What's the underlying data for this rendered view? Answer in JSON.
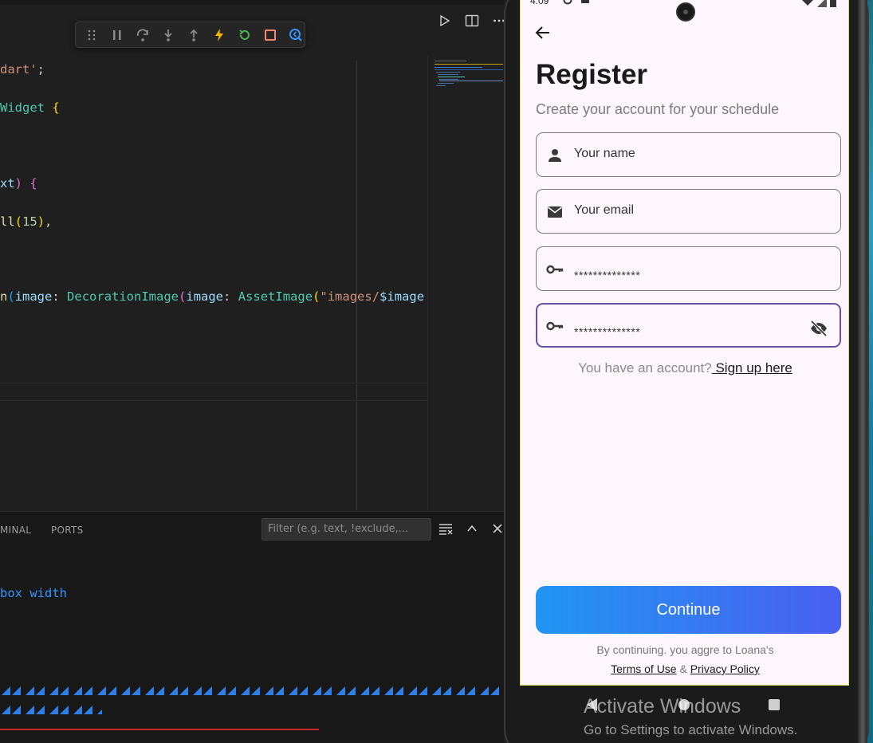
{
  "editor": {
    "code_lines": {
      "l1": "dart'",
      "l1b": ";",
      "l2": "Widget",
      "l3": "xt",
      "l4": "ll",
      "l4n": "15",
      "l5a": "n",
      "l5b": "image",
      "l5c": ": ",
      "l5d": "DecorationImage",
      "l5e": "image",
      "l5f": "AssetImage",
      "l5g": "\"images/",
      "l5h": "$image"
    },
    "panel": {
      "tab_terminal": "MINAL",
      "tab_ports": "PORTS",
      "filter_placeholder": "Filter (e.g. text, !exclude,..."
    },
    "output_text": "box width"
  },
  "phone": {
    "status_time": "4:09",
    "title": "Register",
    "subtitle": "Create your account for your schedule",
    "fields": {
      "name_placeholder": "Your name",
      "email_placeholder": "Your email",
      "password_value": "**************",
      "confirm_value": "**************"
    },
    "account_prompt": "You have an account?",
    "signup_link": " Sign up here",
    "continue_label": "Continue",
    "legal_line1": "By continuing. you aggre to Loana's",
    "terms_link": "Terms of Use",
    "legal_and": " & ",
    "privacy_link": "Privacy Policy"
  },
  "watermark": {
    "line1": "Activate Windows",
    "line2": "Go to Settings to activate Windows."
  },
  "colors": {
    "accent": "#6750a4",
    "button_start": "#2196f3",
    "button_end": "#4a5ff0"
  }
}
